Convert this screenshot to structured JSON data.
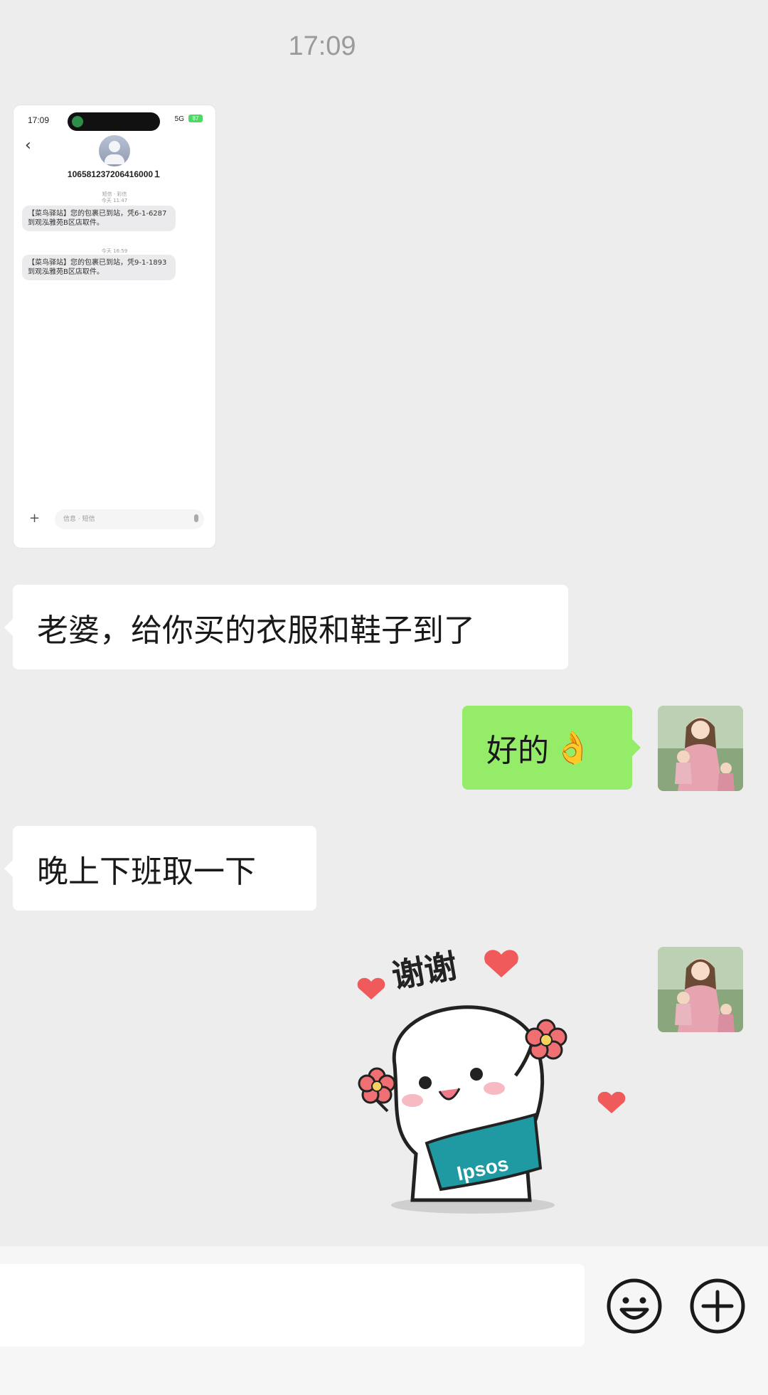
{
  "chat": {
    "timestamp": "17:09",
    "screenshot": {
      "status_time": "17:09",
      "signal": "5G",
      "battery": "87",
      "phone_number": "106581237206416000１",
      "meta_top_line1": "短信 · 彩信",
      "meta_top_line2": "今天 11:47",
      "sms1": "【菜鸟驿站】您的包裹已到站，凭6-1-6287到观泓雅苑B区店取件。",
      "meta_mid": "今天 16:59",
      "sms2": "【菜鸟驿站】您的包裹已到站，凭9-1-1893到观泓雅苑B区店取件。",
      "input_placeholder": "信息 · 短信"
    },
    "messages": [
      {
        "side": "left",
        "text": "老婆，给你买的衣服和鞋子到了"
      },
      {
        "side": "right",
        "text": "好的",
        "emoji": "👌"
      },
      {
        "side": "left",
        "text": "晚上下班取一下"
      }
    ],
    "sticker": {
      "caption": "谢谢",
      "shirt_text": "Ipsos"
    }
  },
  "colors": {
    "background": "#ededed",
    "right_bubble": "#95ec69",
    "left_bubble": "#ffffff"
  },
  "icons": {
    "emoji_button": "smiley-face-icon",
    "more_button": "plus-circle-icon"
  }
}
